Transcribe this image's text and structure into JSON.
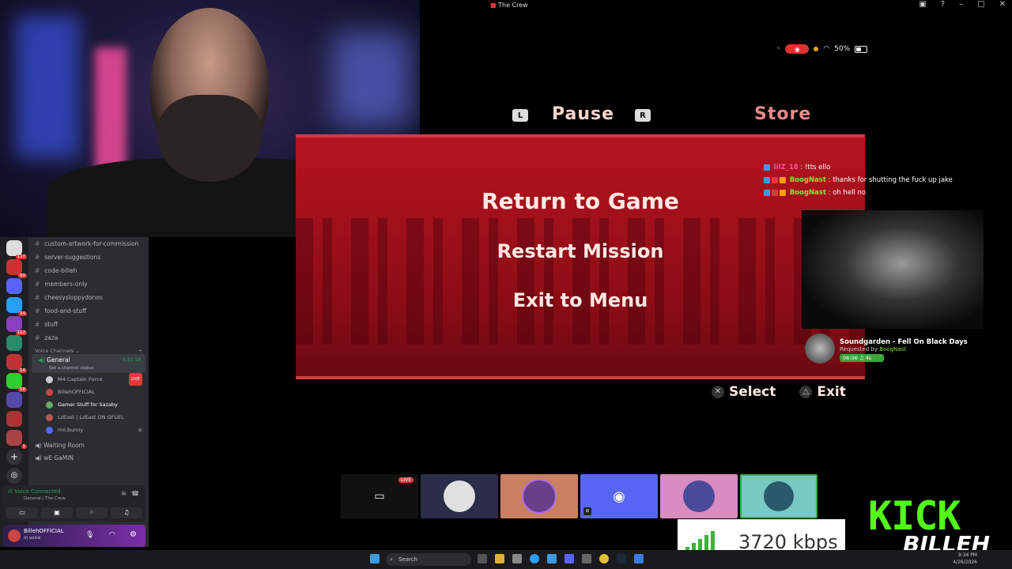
{
  "window": {
    "title": "The Crew"
  },
  "status": {
    "battery": "50%"
  },
  "game": {
    "tabs": {
      "left_button": "L",
      "pause": "Pause",
      "right_button": "R",
      "store": "Store"
    },
    "menu": [
      "Return to Game",
      "Restart Mission",
      "Exit to Menu"
    ],
    "footer": {
      "select": "Select",
      "exit": "Exit"
    }
  },
  "chat": [
    {
      "user": "lilZ_18",
      "text": "!tts ello",
      "color": "#ff4fa0"
    },
    {
      "user": "BoogNast",
      "text": "thanks for shutting the fuck up jake",
      "color": "#8be33a"
    },
    {
      "user": "BoogNast",
      "text": "oh hell no",
      "color": "#8be33a"
    }
  ],
  "music": {
    "title": "Soundgarden - Fell On Black Days",
    "requested_prefix": "Requested by",
    "requested_by": "BoogNast",
    "time": "06:06",
    "extra": "4s"
  },
  "discord": {
    "server_badges": [
      "127",
      "89",
      "",
      "34",
      "112",
      "",
      "14",
      "58",
      "",
      "",
      "1"
    ],
    "text_channels": [
      "custom-artwork-for-commission",
      "server-suggestions",
      "code-billeh",
      "members-only",
      "cheesysloppydonos",
      "food-and-stuff",
      "stuff",
      "zaza"
    ],
    "voice_section": "Voice Channels",
    "active_voice": {
      "name": "General",
      "timer": "5:31:18",
      "status": "Set a channel status"
    },
    "members": [
      {
        "name": "M4 Captain Force",
        "live": "LIVE"
      },
      {
        "name": "BillehOFFICIAL",
        "live": ""
      },
      {
        "name": "Gamer Stuff for Sazaby",
        "live": ""
      },
      {
        "name": "LzEast | LzEast ON GFUEL",
        "live": ""
      },
      {
        "name": "mii.bunny",
        "live": ""
      }
    ],
    "other_voice": [
      "Waiting Room",
      "wE GaMiN"
    ],
    "voice_connected": {
      "title": "Voice Connected",
      "subtitle": "General / The Crew"
    },
    "user": {
      "name": "BillehOFFICIAL",
      "status": "In voice"
    }
  },
  "tiles": {
    "live_badge": "LIVE"
  },
  "kick": {
    "logo": "KICK",
    "name": "BILLEH"
  },
  "bitrate": {
    "value": "3720 kbps"
  },
  "taskbar": {
    "search": "Search",
    "time": "9:34 PM",
    "date": "4/26/2026"
  },
  "colors": {
    "kick_green": "#53fc18",
    "game_red": "#b51420",
    "discord_blurple": "#5865f2"
  }
}
